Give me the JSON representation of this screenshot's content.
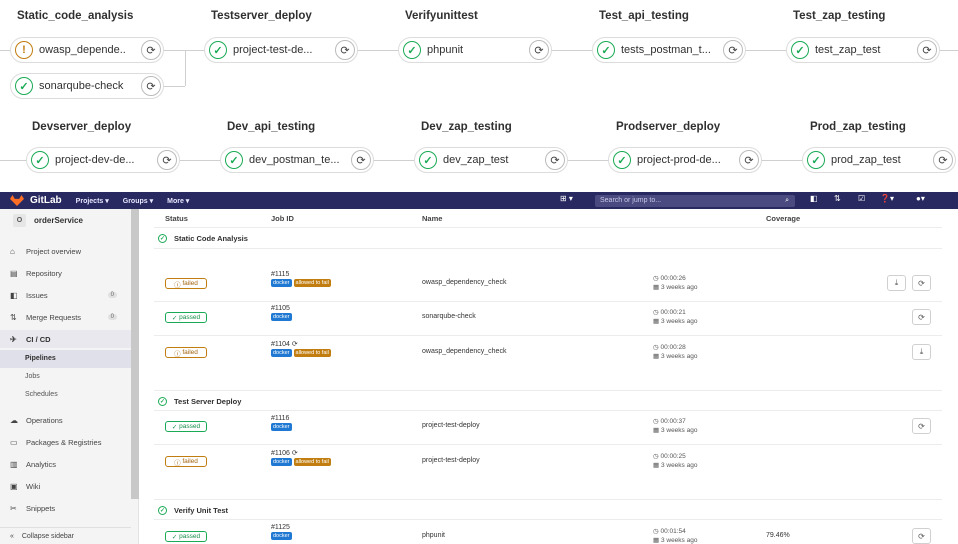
{
  "pipeline_graph": {
    "row1_stages": [
      {
        "title": "Static_code_analysis",
        "jobs": [
          {
            "name": "owasp_depende..",
            "status": "warning"
          },
          {
            "name": "sonarqube-check",
            "status": "passed"
          }
        ]
      },
      {
        "title": "Testserver_deploy",
        "jobs": [
          {
            "name": "project-test-de...",
            "status": "passed"
          }
        ]
      },
      {
        "title": "Verifyunittest",
        "jobs": [
          {
            "name": "phpunit",
            "status": "passed"
          }
        ]
      },
      {
        "title": "Test_api_testing",
        "jobs": [
          {
            "name": "tests_postman_t...",
            "status": "passed"
          }
        ]
      },
      {
        "title": "Test_zap_testing",
        "jobs": [
          {
            "name": "test_zap_test",
            "status": "passed"
          }
        ]
      }
    ],
    "row2_stages": [
      {
        "title": "Devserver_deploy",
        "jobs": [
          {
            "name": "project-dev-de...",
            "status": "passed"
          }
        ]
      },
      {
        "title": "Dev_api_testing",
        "jobs": [
          {
            "name": "dev_postman_te...",
            "status": "passed"
          }
        ]
      },
      {
        "title": "Dev_zap_testing",
        "jobs": [
          {
            "name": "dev_zap_test",
            "status": "passed"
          }
        ]
      },
      {
        "title": "Prodserver_deploy",
        "jobs": [
          {
            "name": "project-prod-de...",
            "status": "passed"
          }
        ]
      },
      {
        "title": "Prod_zap_testing",
        "jobs": [
          {
            "name": "prod_zap_test",
            "status": "passed"
          }
        ]
      }
    ]
  },
  "topnav": {
    "brand": "GitLab",
    "projects": "Projects ▾",
    "groups": "Groups ▾",
    "more": "More ▾",
    "search_placeholder": "Search or jump to..."
  },
  "sidebar": {
    "project_initial": "O",
    "project_name": "orderService",
    "items": [
      {
        "label": "Project overview",
        "icon": "home-icon"
      },
      {
        "label": "Repository",
        "icon": "doc-icon"
      },
      {
        "label": "Issues",
        "icon": "issues-icon",
        "count": "0"
      },
      {
        "label": "Merge Requests",
        "icon": "merge-icon",
        "count": "0"
      },
      {
        "label": "CI / CD",
        "icon": "rocket-icon"
      }
    ],
    "subitems": [
      "Pipelines",
      "Jobs",
      "Schedules"
    ],
    "items2": [
      {
        "label": "Operations",
        "icon": "cloud-icon"
      },
      {
        "label": "Packages & Registries",
        "icon": "package-icon"
      },
      {
        "label": "Analytics",
        "icon": "chart-icon"
      },
      {
        "label": "Wiki",
        "icon": "book-icon"
      },
      {
        "label": "Snippets",
        "icon": "scissors-icon"
      }
    ],
    "collapse": "Collapse sidebar"
  },
  "table": {
    "headers": {
      "status": "Status",
      "job_id": "Job ID",
      "name": "Name",
      "coverage": "Coverage"
    },
    "groups": [
      {
        "title": "Static Code Analysis",
        "jobs": [
          {
            "status": "failed",
            "id": "#1115",
            "retry": false,
            "tags": [
              "docker",
              "allowed to fail"
            ],
            "name": "owasp_dependency_check",
            "duration": "00:00:26",
            "finished": "3 weeks ago",
            "coverage": "",
            "actions": [
              "download",
              "retry"
            ]
          },
          {
            "status": "passed",
            "id": "#1105",
            "retry": false,
            "tags": [
              "docker"
            ],
            "name": "sonarqube-check",
            "duration": "00:00:21",
            "finished": "3 weeks ago",
            "coverage": "",
            "actions": [
              "retry"
            ]
          },
          {
            "status": "failed",
            "id": "#1104",
            "retry": true,
            "tags": [
              "docker",
              "allowed to fail"
            ],
            "name": "owasp_dependency_check",
            "duration": "00:00:28",
            "finished": "3 weeks ago",
            "coverage": "",
            "actions": [
              "download"
            ]
          }
        ]
      },
      {
        "title": "Test Server Deploy",
        "jobs": [
          {
            "status": "passed",
            "id": "#1116",
            "retry": false,
            "tags": [
              "docker"
            ],
            "name": "project-test-deploy",
            "duration": "00:00:37",
            "finished": "3 weeks ago",
            "coverage": "",
            "actions": [
              "retry"
            ]
          },
          {
            "status": "failed",
            "id": "#1106",
            "retry": true,
            "tags": [
              "docker",
              "allowed to fail"
            ],
            "name": "project-test-deploy",
            "duration": "00:00:25",
            "finished": "3 weeks ago",
            "coverage": "",
            "actions": []
          }
        ]
      },
      {
        "title": "Verify Unit Test",
        "jobs": [
          {
            "status": "passed",
            "id": "#1125",
            "retry": false,
            "tags": [
              "docker"
            ],
            "name": "phpunit",
            "duration": "00:01:54",
            "finished": "3 weeks ago",
            "coverage": "79.46%",
            "actions": [
              "retry"
            ]
          }
        ]
      }
    ]
  },
  "colors": {
    "nav": "#292961",
    "success": "#1aaa55",
    "warning": "#c17d10",
    "docker": "#1f78d1"
  }
}
